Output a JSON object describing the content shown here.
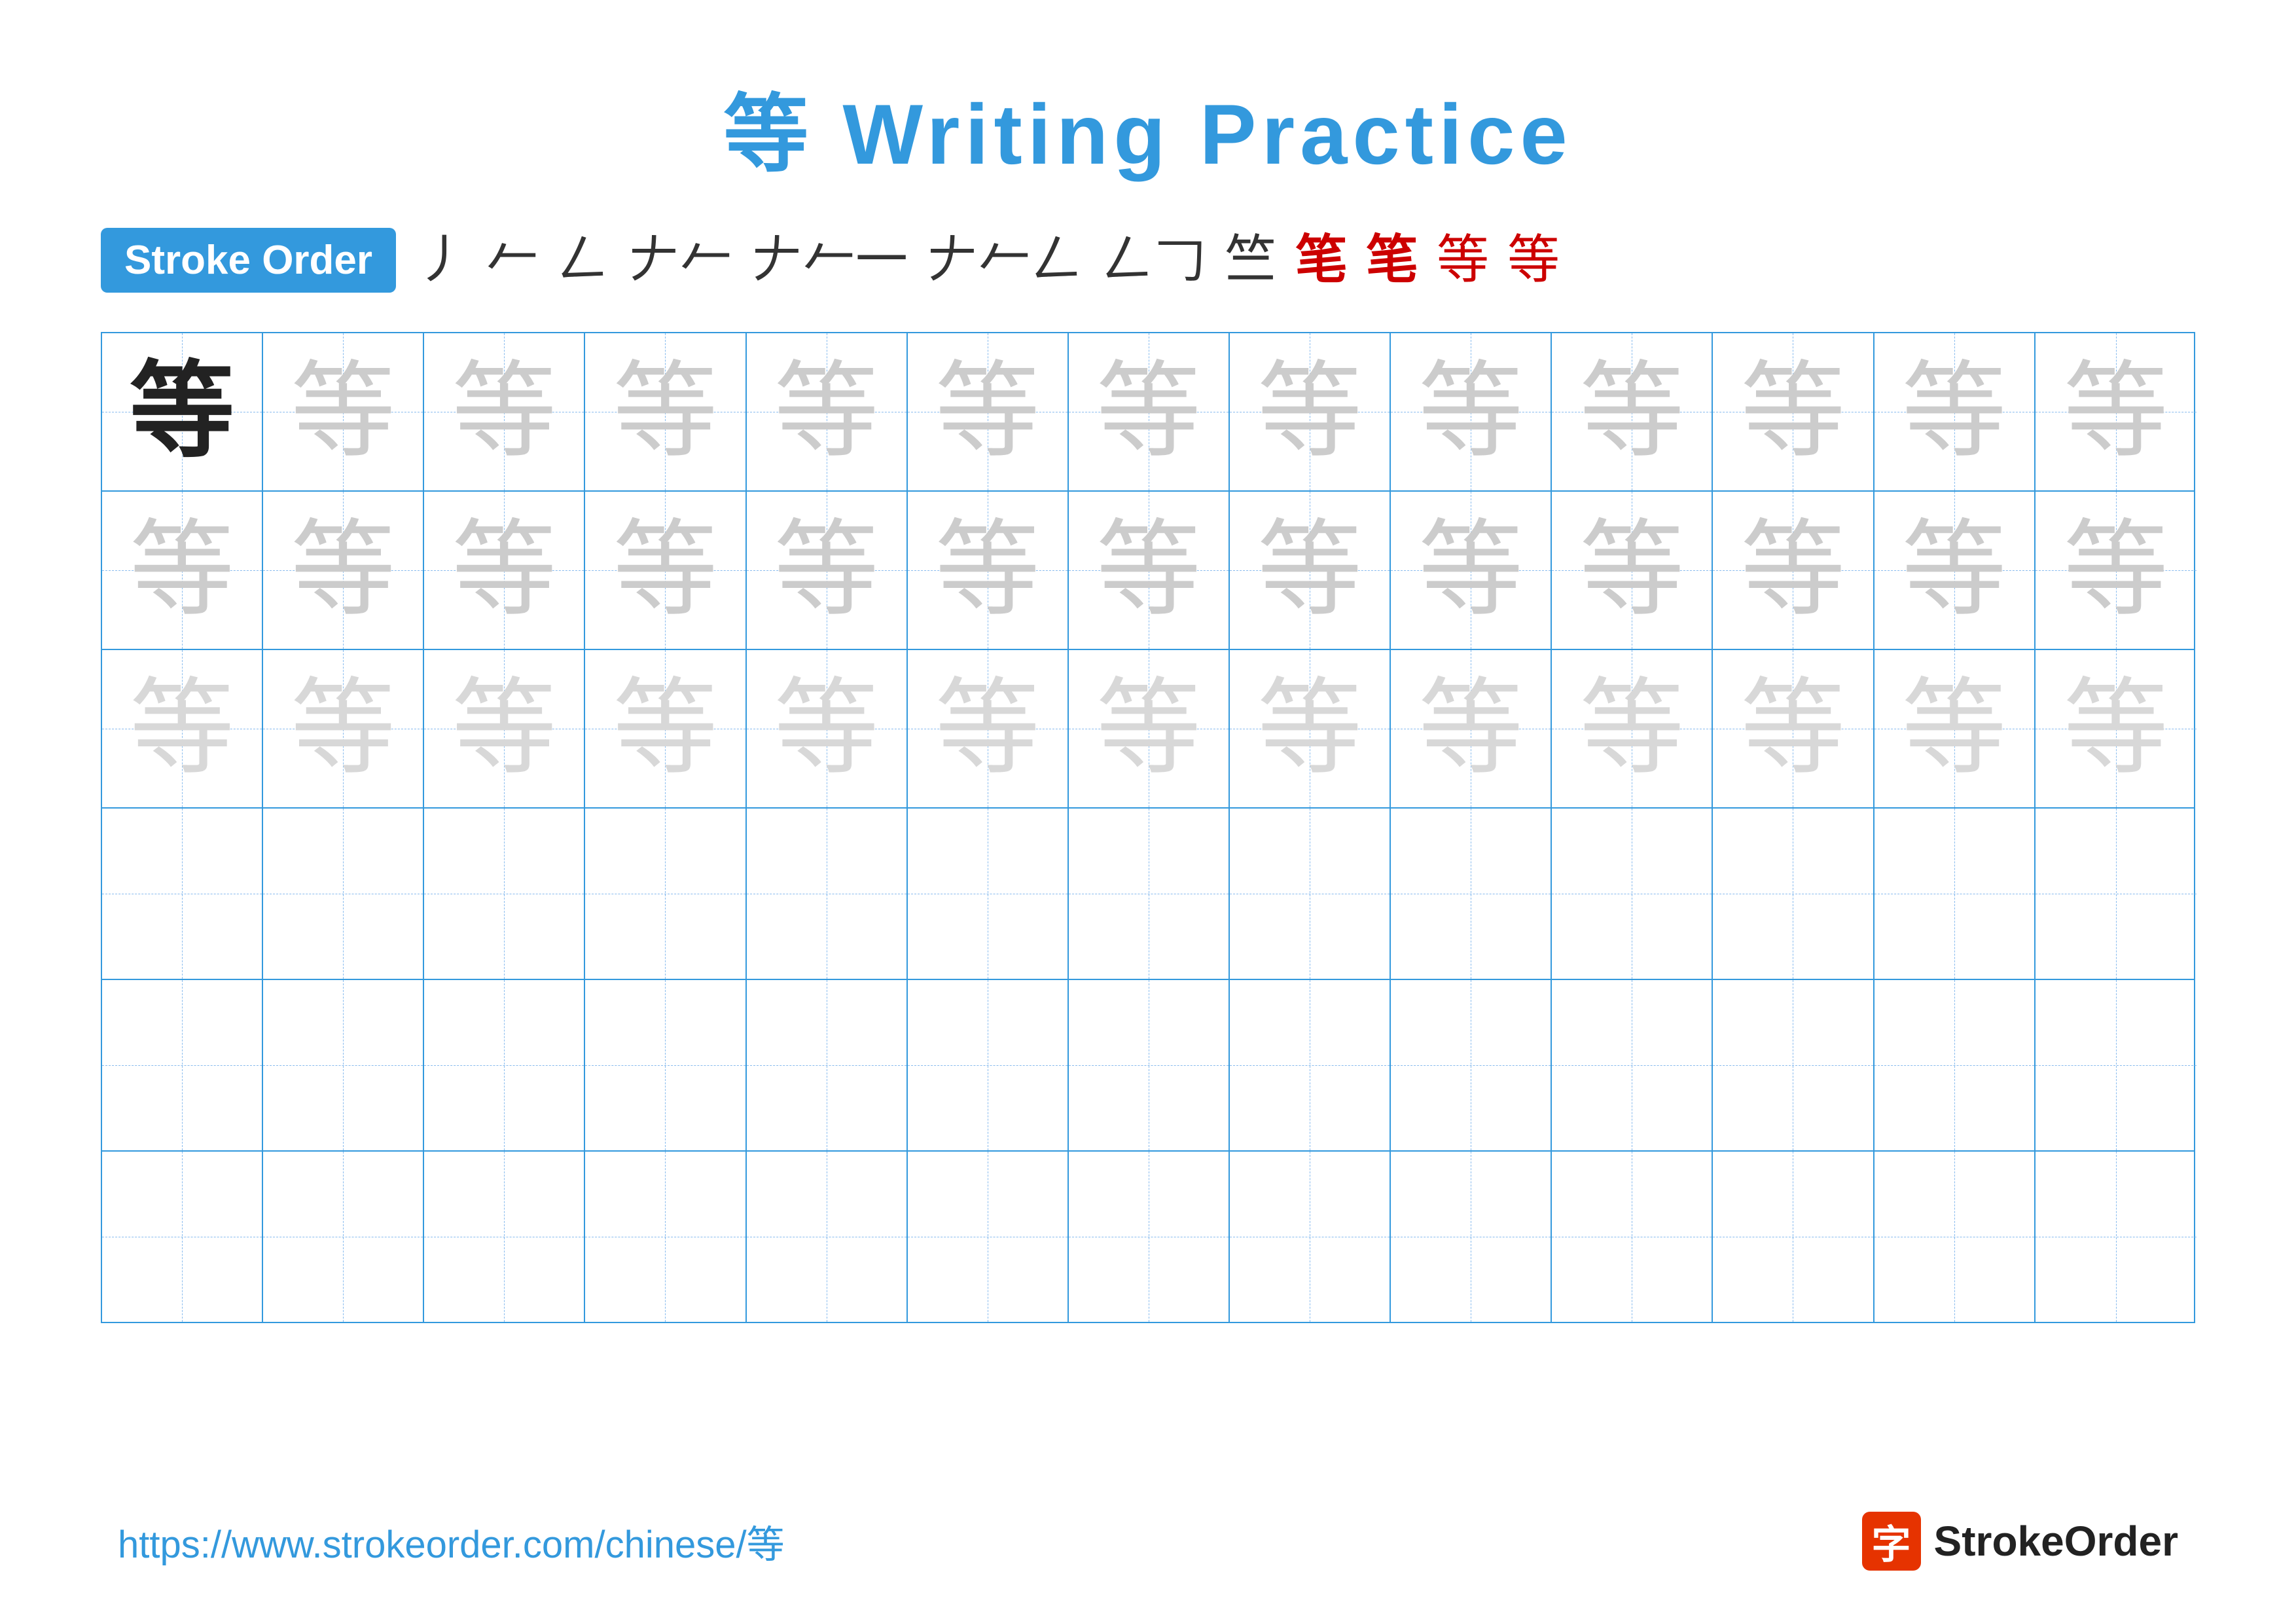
{
  "title": {
    "char": "等",
    "text": " Writing Practice"
  },
  "stroke_order": {
    "badge_label": "Stroke Order",
    "steps": [
      "丿",
      "𠂉",
      "𠂇",
      "𠂇丿",
      "𠂇丿一",
      "𠂇丿𠃋",
      "𠃋𠃌",
      "𠃋𠃌𠃎",
      "竺",
      "等",
      "等",
      "等"
    ]
  },
  "grid": {
    "rows": 6,
    "cols": 13,
    "char": "等",
    "row1_style": "guided",
    "row2_style": "light",
    "row3_style": "lighter",
    "row4_style": "empty",
    "row5_style": "empty",
    "row6_style": "empty"
  },
  "footer": {
    "url": "https://www.strokeorder.com/chinese/等",
    "logo_char": "字",
    "logo_text": "StrokeOrder"
  }
}
